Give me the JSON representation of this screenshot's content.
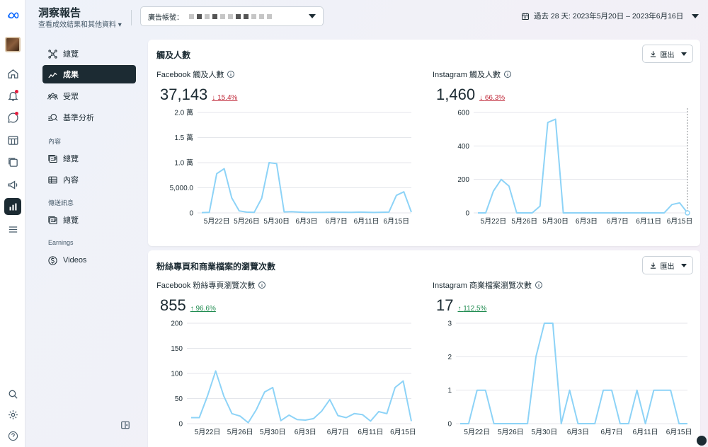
{
  "app": {
    "title": "洞察報告",
    "subtitle": "查看成效結果和其他資料"
  },
  "account": {
    "label": "廣告帳號："
  },
  "date_range": {
    "label": "過去 28 天: 2023年5月20日 – 2023年6月16日"
  },
  "nav": {
    "items": [
      {
        "label": "總覽",
        "icon": "overview-icon"
      },
      {
        "label": "成果",
        "icon": "results-icon",
        "active": true
      },
      {
        "label": "受眾",
        "icon": "audience-icon"
      },
      {
        "label": "基準分析",
        "icon": "benchmark-icon"
      }
    ],
    "content_section": "內容",
    "content_items": [
      {
        "label": "總覽",
        "icon": "content-overview-icon"
      },
      {
        "label": "內容",
        "icon": "content-table-icon"
      }
    ],
    "messaging_section": "傳送訊息",
    "messaging_items": [
      {
        "label": "總覽",
        "icon": "messaging-overview-icon"
      }
    ],
    "earnings_section": "Earnings",
    "earnings_items": [
      {
        "label": "Videos",
        "icon": "dollar-icon"
      }
    ]
  },
  "export_label": "匯出",
  "cards": [
    {
      "title": "觸及人數",
      "panels": [
        {
          "label": "Facebook 觸及人數",
          "value": "37,143",
          "delta": "15.4%",
          "trend": "down"
        },
        {
          "label": "Instagram 觸及人數",
          "value": "1,460",
          "delta": "66.3%",
          "trend": "down"
        }
      ]
    },
    {
      "title": "粉絲專頁和商業檔案的瀏覽次數",
      "panels": [
        {
          "label": "Facebook 粉絲專頁瀏覽次數",
          "value": "855",
          "delta": "96.6%",
          "trend": "up"
        },
        {
          "label": "Instagram 商業檔案瀏覽次數",
          "value": "17",
          "delta": "112.5%",
          "trend": "up"
        }
      ]
    }
  ],
  "chart_data": [
    {
      "type": "line",
      "title": "Facebook 觸及人數",
      "x_tick_labels": [
        "5月22日",
        "5月26日",
        "5月30日",
        "6月3日",
        "6月7日",
        "6月11日",
        "6月15日"
      ],
      "y_tick_labels": [
        "0",
        "5,000.0",
        "1.0 萬",
        "1.5 萬",
        "2.0 萬"
      ],
      "ylim": [
        0,
        20000
      ],
      "x": [
        "5/20",
        "5/21",
        "5/22",
        "5/23",
        "5/24",
        "5/25",
        "5/26",
        "5/27",
        "5/28",
        "5/29",
        "5/30",
        "5/31",
        "6/1",
        "6/2",
        "6/3",
        "6/4",
        "6/5",
        "6/6",
        "6/7",
        "6/8",
        "6/9",
        "6/10",
        "6/11",
        "6/12",
        "6/13",
        "6/14",
        "6/15",
        "6/16"
      ],
      "values": [
        50,
        100,
        7800,
        8800,
        3000,
        400,
        150,
        100,
        2900,
        10000,
        9800,
        200,
        250,
        150,
        80,
        100,
        100,
        120,
        130,
        120,
        100,
        160,
        130,
        90,
        120,
        150,
        3500,
        4200,
        150
      ]
    },
    {
      "type": "line",
      "title": "Instagram 觸及人數",
      "x_tick_labels": [
        "5月22日",
        "5月26日",
        "5月30日",
        "6月3日",
        "6月7日",
        "6月11日",
        "6月15日"
      ],
      "y_tick_labels": [
        "0",
        "200",
        "400",
        "600"
      ],
      "ylim": [
        0,
        600
      ],
      "x": [
        "5/20",
        "5/21",
        "5/22",
        "5/23",
        "5/24",
        "5/25",
        "5/26",
        "5/27",
        "5/28",
        "5/29",
        "5/30",
        "5/31",
        "6/1",
        "6/2",
        "6/3",
        "6/4",
        "6/5",
        "6/6",
        "6/7",
        "6/8",
        "6/9",
        "6/10",
        "6/11",
        "6/12",
        "6/13",
        "6/14",
        "6/15",
        "6/16"
      ],
      "values": [
        0,
        0,
        130,
        200,
        160,
        0,
        0,
        0,
        40,
        540,
        560,
        0,
        0,
        0,
        0,
        0,
        0,
        0,
        0,
        0,
        0,
        0,
        0,
        0,
        0,
        50,
        60,
        0
      ]
    },
    {
      "type": "line",
      "title": "Facebook 粉絲專頁瀏覽次數",
      "x_tick_labels": [
        "5月22日",
        "5月26日",
        "5月30日",
        "6月3日",
        "6月7日",
        "6月11日",
        "6月15日"
      ],
      "y_tick_labels": [
        "0",
        "50",
        "100",
        "150",
        "200"
      ],
      "ylim": [
        0,
        200
      ],
      "x": [
        "5/20",
        "5/21",
        "5/22",
        "5/23",
        "5/24",
        "5/25",
        "5/26",
        "5/27",
        "5/28",
        "5/29",
        "5/30",
        "5/31",
        "6/1",
        "6/2",
        "6/3",
        "6/4",
        "6/5",
        "6/6",
        "6/7",
        "6/8",
        "6/9",
        "6/10",
        "6/11",
        "6/12",
        "6/13",
        "6/14",
        "6/15",
        "6/16"
      ],
      "values": [
        12,
        12,
        55,
        105,
        55,
        20,
        15,
        2,
        28,
        63,
        72,
        6,
        17,
        8,
        7,
        10,
        25,
        48,
        16,
        12,
        20,
        18,
        5,
        24,
        20,
        72,
        85,
        5
      ]
    },
    {
      "type": "line",
      "title": "Instagram 商業檔案瀏覽次數",
      "x_tick_labels": [
        "5月22日",
        "5月26日",
        "5月30日",
        "6月3日",
        "6月7日",
        "6月11日",
        "6月15日"
      ],
      "y_tick_labels": [
        "0",
        "1",
        "2",
        "3"
      ],
      "ylim": [
        0,
        3
      ],
      "x": [
        "5/20",
        "5/21",
        "5/22",
        "5/23",
        "5/24",
        "5/25",
        "5/26",
        "5/27",
        "5/28",
        "5/29",
        "5/30",
        "5/31",
        "6/1",
        "6/2",
        "6/3",
        "6/4",
        "6/5",
        "6/6",
        "6/7",
        "6/8",
        "6/9",
        "6/10",
        "6/11",
        "6/12",
        "6/13",
        "6/14",
        "6/15",
        "6/16"
      ],
      "values": [
        0,
        0,
        1,
        1,
        0,
        0,
        0,
        0,
        0,
        2,
        3,
        3,
        0,
        1,
        0,
        0,
        0,
        1,
        1,
        0,
        0,
        1,
        0,
        1,
        1,
        1,
        0,
        0
      ]
    }
  ]
}
